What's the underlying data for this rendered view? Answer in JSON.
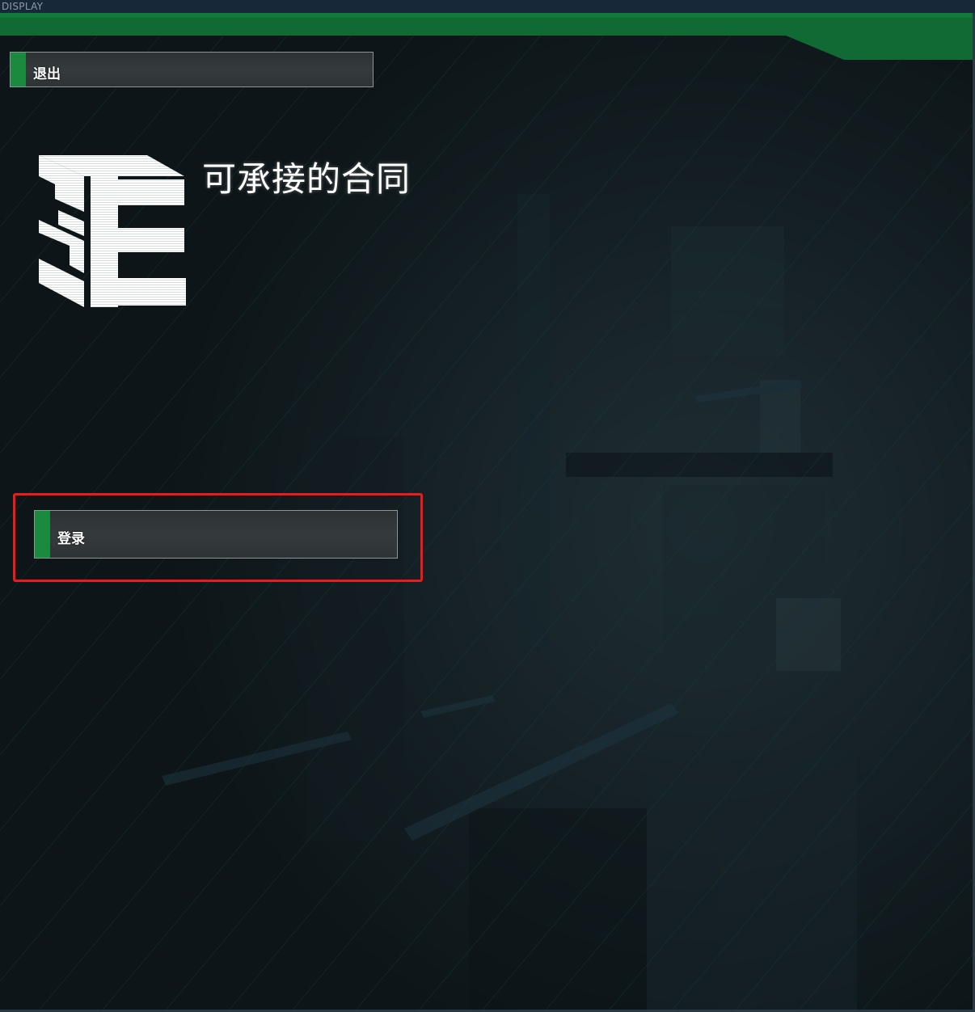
{
  "window": {
    "title": "DISPLAY"
  },
  "toolbar": {
    "exit_label": "退出"
  },
  "main": {
    "title": "可承接的合同",
    "login_label": "登录",
    "logo_icon": "3e-logo-icon"
  },
  "colors": {
    "accent_green": "#1a8a3e",
    "highlight_red": "#f01818",
    "background": "#0e161a"
  }
}
